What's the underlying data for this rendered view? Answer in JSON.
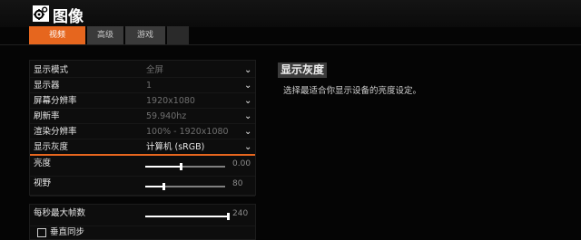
{
  "window": {
    "title": "图像",
    "icon": "gears-icon"
  },
  "tabs": [
    {
      "label": "视频",
      "active": true
    },
    {
      "label": "高级",
      "active": false
    },
    {
      "label": "游戏",
      "active": false
    }
  ],
  "settings": [
    {
      "label": "显示模式",
      "value": "全屏"
    },
    {
      "label": "显示器",
      "value": "1"
    },
    {
      "label": "屏幕分辨率",
      "value": "1920x1080"
    },
    {
      "label": "刷新率",
      "value": "59.940hz"
    },
    {
      "label": "渲染分辨率",
      "value": "100% - 1920x1080"
    },
    {
      "label": "显示灰度",
      "value": "计算机 (sRGB)"
    }
  ],
  "sliders": {
    "brightness": {
      "label": "亮度",
      "value": "0.00",
      "fraction": 0.45
    },
    "fov": {
      "label": "视野",
      "value": "80",
      "fraction": 0.24
    }
  },
  "performance": {
    "max_fps": {
      "label": "每秒最大帧数",
      "value": "240",
      "fraction": 1.0
    },
    "vsync": {
      "label": "垂直同步",
      "checked": false
    }
  },
  "info": {
    "title": "显示灰度",
    "description": "选择最适合你显示设备的亮度设定。"
  },
  "colors": {
    "accent": "#e6661e",
    "background": "#050505"
  }
}
